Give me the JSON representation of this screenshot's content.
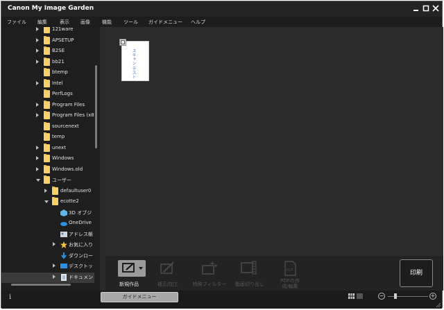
{
  "window": {
    "title": "Canon My Image Garden"
  },
  "menu": [
    "ファイル",
    "編集",
    "表示",
    "画像",
    "機能",
    "ツール",
    "ガイドメニュー",
    "ヘルプ"
  ],
  "tree": [
    {
      "label": "121ware",
      "arrow": "right",
      "icon": "folder"
    },
    {
      "label": "APSETUP",
      "arrow": "right",
      "icon": "folder"
    },
    {
      "label": "B2SE",
      "arrow": "right",
      "icon": "folder"
    },
    {
      "label": "bb21",
      "arrow": "right",
      "icon": "folder"
    },
    {
      "label": "btemp",
      "arrow": "none",
      "icon": "folder"
    },
    {
      "label": "Intel",
      "arrow": "right",
      "icon": "folder"
    },
    {
      "label": "PerfLogs",
      "arrow": "none",
      "icon": "folder"
    },
    {
      "label": "Program Files",
      "arrow": "right",
      "icon": "folder"
    },
    {
      "label": "Program Files (x8",
      "arrow": "right",
      "icon": "folder"
    },
    {
      "label": "sourcenext",
      "arrow": "none",
      "icon": "folder"
    },
    {
      "label": "temp",
      "arrow": "none",
      "icon": "folder"
    },
    {
      "label": "unext",
      "arrow": "right",
      "icon": "folder"
    },
    {
      "label": "Windows",
      "arrow": "right",
      "icon": "folder"
    },
    {
      "label": "Windows.old",
      "arrow": "right",
      "icon": "folder"
    },
    {
      "label": "ユーザー",
      "arrow": "down",
      "icon": "folder"
    },
    {
      "label": "defaultuser0",
      "arrow": "right",
      "icon": "folder"
    },
    {
      "label": "ecotte2",
      "arrow": "down",
      "icon": "folder"
    },
    {
      "label": "3D オブジ",
      "arrow": "none",
      "icon": "3d-objects-icon"
    },
    {
      "label": "OneDrive",
      "arrow": "none",
      "icon": "onedrive-icon"
    },
    {
      "label": "アドレス帳",
      "arrow": "none",
      "icon": "contacts-icon"
    },
    {
      "label": "お気に入り",
      "arrow": "right",
      "icon": "favorites-star-icon"
    },
    {
      "label": "ダウンロー",
      "arrow": "none",
      "icon": "download-arrow-icon"
    },
    {
      "label": "デスクトッ",
      "arrow": "right",
      "icon": "desktop-icon"
    },
    {
      "label": "ドキュメン",
      "arrow": "right",
      "icon": "documents-icon"
    }
  ],
  "thumbnail": {
    "text": "スキャン テスト"
  },
  "toolbar": {
    "tools": [
      {
        "label": "新規作品",
        "enabled": true,
        "icon": "new-item-icon"
      },
      {
        "label": "補正/加工",
        "enabled": false,
        "icon": "correct-edit-icon"
      },
      {
        "label": "特殊フィルター",
        "enabled": false,
        "icon": "special-filter-icon"
      },
      {
        "label": "動画切り出し",
        "enabled": false,
        "icon": "video-frame-icon"
      },
      {
        "label": "PDFの作成/編集",
        "enabled": false,
        "icon": "pdf-icon"
      }
    ],
    "print_label": "印刷"
  },
  "status": {
    "guide_menu_label": "ガイドメニュー",
    "info_glyph": "i",
    "zoom_minus": "−",
    "zoom_plus": "+"
  },
  "colors": {
    "window_bg": "#1b1b1b",
    "folder": "#f6d06b"
  }
}
